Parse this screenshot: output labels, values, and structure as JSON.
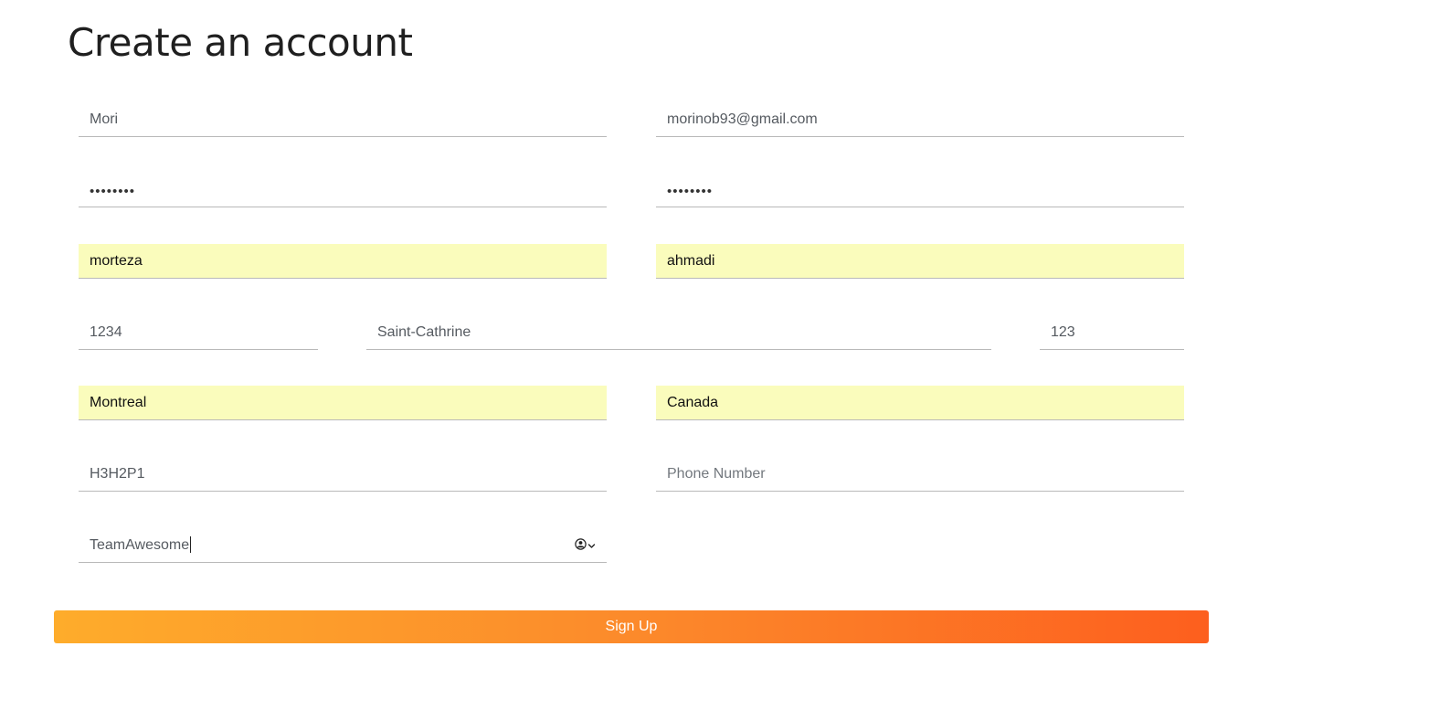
{
  "page": {
    "title": "Create an account"
  },
  "form": {
    "username": {
      "value": "Mori"
    },
    "email": {
      "value": "morinob93@gmail.com"
    },
    "password": {
      "value": "••••••••"
    },
    "confirm_password": {
      "value": "••••••••"
    },
    "first_name": {
      "value": "morteza"
    },
    "last_name": {
      "value": "ahmadi"
    },
    "street_number": {
      "value": "1234"
    },
    "street_name": {
      "value": "Saint-Cathrine"
    },
    "apartment": {
      "value": "123"
    },
    "city": {
      "value": "Montreal"
    },
    "country": {
      "value": "Canada"
    },
    "postal_code": {
      "value": "H3H2P1"
    },
    "phone": {
      "value": "",
      "placeholder": "Phone Number"
    },
    "team": {
      "value": "TeamAwesome"
    }
  },
  "actions": {
    "signup_label": "Sign Up"
  },
  "colors": {
    "autofill_bg": "#fafcbc",
    "button_gradient_start": "#feac2b",
    "button_gradient_end": "#fd5f1e",
    "underline": "#b9b9b9"
  },
  "icons": {
    "team_field": [
      "user-circle-icon",
      "chevron-down-icon"
    ]
  }
}
